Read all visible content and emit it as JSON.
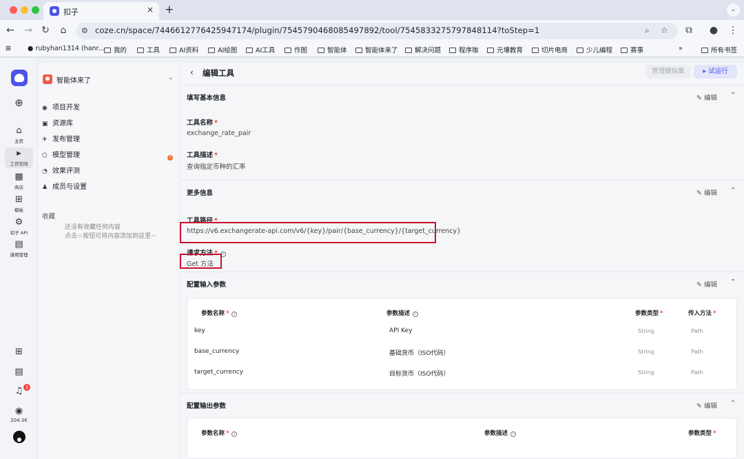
{
  "browser": {
    "tab_title": "扣子",
    "tab_close": "×",
    "tab_new": "+",
    "url": "coze.cn/space/7446612776425947174/plugin/7545790468085497892/tool/7545833275797848114?toStep=1",
    "bookmarks": [
      "rubyhan1314 (hanr...",
      "我的",
      "工具",
      "AI资料",
      "AI绘图",
      "AI工具",
      "作图",
      "智能体",
      "智能体来了",
      "解决问题",
      "程序咖",
      "元壤教育",
      "切片电商",
      "少儿编程",
      "赛事"
    ],
    "bookmarks_overflow": "»",
    "all_bookmarks": "所有书签"
  },
  "rail": {
    "items": [
      {
        "icon": "⌂",
        "label": "主页"
      },
      {
        "icon": "▸",
        "label": "工作空间"
      },
      {
        "icon": "▦",
        "label": "商店"
      },
      {
        "icon": "⊞",
        "label": "模板"
      },
      {
        "icon": "⚙",
        "label": "扣子 API"
      },
      {
        "icon": "▤",
        "label": "通用管理"
      }
    ],
    "notifications_badge": "3",
    "stars": "204.3K"
  },
  "sidebar": {
    "workspace_name": "智能体来了",
    "menu": [
      {
        "icon": "◉",
        "label": "项目开发"
      },
      {
        "icon": "▣",
        "label": "资源库"
      },
      {
        "icon": "✈",
        "label": "发布管理"
      },
      {
        "icon": "⬡",
        "label": "模型管理"
      },
      {
        "icon": "◔",
        "label": "效果评测"
      },
      {
        "icon": "♟",
        "label": "成员与设置"
      }
    ],
    "model_badge": "!",
    "favorites_title": "收藏",
    "favorites_empty_line1": "还没有收藏任何内容",
    "favorites_empty_line2": "点击☆按钮可将内容添加到这里~"
  },
  "header": {
    "back": "‹",
    "title": "编辑工具",
    "mock_button": "管理模拟集",
    "run_button": "▸ 试运行"
  },
  "common": {
    "edit": "编辑",
    "collapse": "⌃"
  },
  "basic_info": {
    "title": "填写基本信息",
    "name_label": "工具名称",
    "name_value": "exchange_rate_pair",
    "desc_label": "工具描述",
    "desc_value": "查询指定币种的汇率"
  },
  "more_info": {
    "title": "更多信息",
    "path_label": "工具路径",
    "path_value": "https://v6.exchangerate-api.com/v6/{key}/pair/{base_currency}/{target_currency}",
    "method_label": "请求方法",
    "method_value": "Get 方法"
  },
  "input_params": {
    "title": "配置输入参数",
    "headers": {
      "name": "参数名称",
      "desc": "参数描述",
      "type": "参数类型",
      "method": "传入方法"
    },
    "rows": [
      {
        "name": "key",
        "desc": "API Key",
        "type": "String",
        "method": "Path"
      },
      {
        "name": "base_currency",
        "desc": "基础货币（ISO代码）",
        "type": "String",
        "method": "Path"
      },
      {
        "name": "target_currency",
        "desc": "目标货币（ISO代码）",
        "type": "String",
        "method": "Path"
      }
    ]
  },
  "output_params": {
    "title": "配置输出参数",
    "headers": {
      "name": "参数名称",
      "desc": "参数描述",
      "type": "参数类型"
    }
  },
  "colors": {
    "accent": "#4d53e8",
    "highlight": "#c8102e",
    "required": "#f53f3f"
  }
}
